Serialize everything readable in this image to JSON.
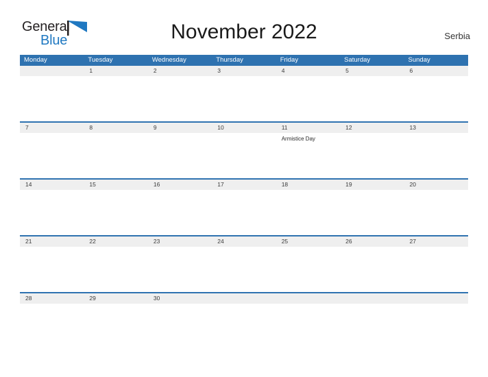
{
  "brand": {
    "name_part1": "General",
    "name_part2": "Blue",
    "flag_icon": "blue-flag-triangle",
    "color_dark": "#231f20",
    "color_blue": "#1f78c1"
  },
  "header": {
    "title": "November 2022",
    "country": "Serbia"
  },
  "theme": {
    "header_blue": "#2e72b0",
    "row_band_grey": "#efefef",
    "page_background": "#ffffff"
  },
  "calendar": {
    "weekdays": [
      "Monday",
      "Tuesday",
      "Wednesday",
      "Thursday",
      "Friday",
      "Saturday",
      "Sunday"
    ],
    "weeks": [
      {
        "days": [
          {
            "num": "",
            "event": ""
          },
          {
            "num": "1",
            "event": ""
          },
          {
            "num": "2",
            "event": ""
          },
          {
            "num": "3",
            "event": ""
          },
          {
            "num": "4",
            "event": ""
          },
          {
            "num": "5",
            "event": ""
          },
          {
            "num": "6",
            "event": ""
          }
        ]
      },
      {
        "days": [
          {
            "num": "7",
            "event": ""
          },
          {
            "num": "8",
            "event": ""
          },
          {
            "num": "9",
            "event": ""
          },
          {
            "num": "10",
            "event": ""
          },
          {
            "num": "11",
            "event": "Armistice Day"
          },
          {
            "num": "12",
            "event": ""
          },
          {
            "num": "13",
            "event": ""
          }
        ]
      },
      {
        "days": [
          {
            "num": "14",
            "event": ""
          },
          {
            "num": "15",
            "event": ""
          },
          {
            "num": "16",
            "event": ""
          },
          {
            "num": "17",
            "event": ""
          },
          {
            "num": "18",
            "event": ""
          },
          {
            "num": "19",
            "event": ""
          },
          {
            "num": "20",
            "event": ""
          }
        ]
      },
      {
        "days": [
          {
            "num": "21",
            "event": ""
          },
          {
            "num": "22",
            "event": ""
          },
          {
            "num": "23",
            "event": ""
          },
          {
            "num": "24",
            "event": ""
          },
          {
            "num": "25",
            "event": ""
          },
          {
            "num": "26",
            "event": ""
          },
          {
            "num": "27",
            "event": ""
          }
        ]
      },
      {
        "days": [
          {
            "num": "28",
            "event": ""
          },
          {
            "num": "29",
            "event": ""
          },
          {
            "num": "30",
            "event": ""
          },
          {
            "num": "",
            "event": ""
          },
          {
            "num": "",
            "event": ""
          },
          {
            "num": "",
            "event": ""
          },
          {
            "num": "",
            "event": ""
          }
        ]
      }
    ]
  }
}
